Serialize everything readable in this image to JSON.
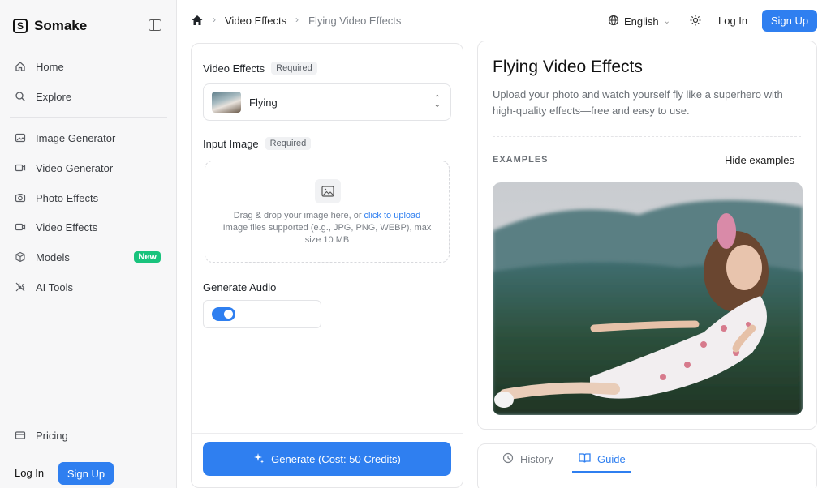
{
  "brand": {
    "name": "Somake"
  },
  "sidebar": {
    "items": [
      {
        "label": "Home",
        "icon": "home-icon"
      },
      {
        "label": "Explore",
        "icon": "search-icon"
      },
      {
        "label": "Image Generator",
        "icon": "image-icon"
      },
      {
        "label": "Video Generator",
        "icon": "video-icon"
      },
      {
        "label": "Photo Effects",
        "icon": "camera-icon"
      },
      {
        "label": "Video Effects",
        "icon": "video-icon"
      },
      {
        "label": "Models",
        "icon": "cube-icon",
        "badge": "New"
      },
      {
        "label": "AI Tools",
        "icon": "tools-icon"
      },
      {
        "label": "Pricing",
        "icon": "card-icon"
      }
    ],
    "login": "Log In",
    "signup": "Sign Up"
  },
  "topbar": {
    "breadcrumb": [
      "Video Effects",
      "Flying Video Effects"
    ],
    "language": "English",
    "login": "Log In",
    "signup": "Sign Up"
  },
  "form": {
    "effect_label": "Video Effects",
    "required": "Required",
    "effect_value": "Flying",
    "image_label": "Input Image",
    "dropzone_text": "Drag & drop your image here, or",
    "dropzone_link": "click to upload",
    "dropzone_hint": "Image files supported (e.g., JPG, PNG, WEBP), max size 10 MB",
    "audio_label": "Generate Audio",
    "audio_enabled": true,
    "generate_label": "Generate (Cost: 50 Credits)"
  },
  "info": {
    "title": "Flying Video Effects",
    "description": "Upload your photo and watch yourself fly like a superhero with high-quality effects—free and easy to use.",
    "examples_label": "EXAMPLES",
    "hide_examples": "Hide examples"
  },
  "tabs": [
    {
      "label": "History",
      "icon": "clock-icon"
    },
    {
      "label": "Guide",
      "icon": "book-icon"
    }
  ],
  "colors": {
    "accent": "#2f7ff0",
    "badge_green": "#19c37d"
  }
}
